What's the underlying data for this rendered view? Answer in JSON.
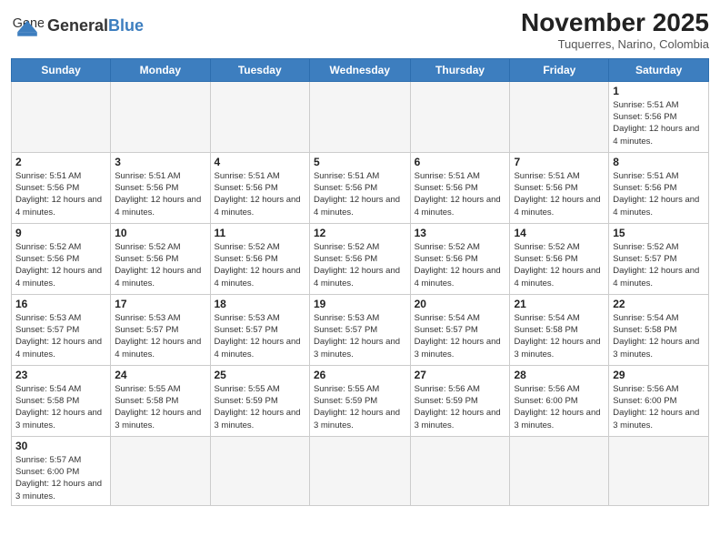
{
  "header": {
    "logo_general": "General",
    "logo_blue": "Blue",
    "month_title": "November 2025",
    "subtitle": "Tuquerres, Narino, Colombia"
  },
  "days_of_week": [
    "Sunday",
    "Monday",
    "Tuesday",
    "Wednesday",
    "Thursday",
    "Friday",
    "Saturday"
  ],
  "weeks": [
    [
      {
        "day": "",
        "info": ""
      },
      {
        "day": "",
        "info": ""
      },
      {
        "day": "",
        "info": ""
      },
      {
        "day": "",
        "info": ""
      },
      {
        "day": "",
        "info": ""
      },
      {
        "day": "",
        "info": ""
      },
      {
        "day": "1",
        "info": "Sunrise: 5:51 AM\nSunset: 5:56 PM\nDaylight: 12 hours and 4 minutes."
      }
    ],
    [
      {
        "day": "2",
        "info": "Sunrise: 5:51 AM\nSunset: 5:56 PM\nDaylight: 12 hours and 4 minutes."
      },
      {
        "day": "3",
        "info": "Sunrise: 5:51 AM\nSunset: 5:56 PM\nDaylight: 12 hours and 4 minutes."
      },
      {
        "day": "4",
        "info": "Sunrise: 5:51 AM\nSunset: 5:56 PM\nDaylight: 12 hours and 4 minutes."
      },
      {
        "day": "5",
        "info": "Sunrise: 5:51 AM\nSunset: 5:56 PM\nDaylight: 12 hours and 4 minutes."
      },
      {
        "day": "6",
        "info": "Sunrise: 5:51 AM\nSunset: 5:56 PM\nDaylight: 12 hours and 4 minutes."
      },
      {
        "day": "7",
        "info": "Sunrise: 5:51 AM\nSunset: 5:56 PM\nDaylight: 12 hours and 4 minutes."
      },
      {
        "day": "8",
        "info": "Sunrise: 5:51 AM\nSunset: 5:56 PM\nDaylight: 12 hours and 4 minutes."
      }
    ],
    [
      {
        "day": "9",
        "info": "Sunrise: 5:52 AM\nSunset: 5:56 PM\nDaylight: 12 hours and 4 minutes."
      },
      {
        "day": "10",
        "info": "Sunrise: 5:52 AM\nSunset: 5:56 PM\nDaylight: 12 hours and 4 minutes."
      },
      {
        "day": "11",
        "info": "Sunrise: 5:52 AM\nSunset: 5:56 PM\nDaylight: 12 hours and 4 minutes."
      },
      {
        "day": "12",
        "info": "Sunrise: 5:52 AM\nSunset: 5:56 PM\nDaylight: 12 hours and 4 minutes."
      },
      {
        "day": "13",
        "info": "Sunrise: 5:52 AM\nSunset: 5:56 PM\nDaylight: 12 hours and 4 minutes."
      },
      {
        "day": "14",
        "info": "Sunrise: 5:52 AM\nSunset: 5:56 PM\nDaylight: 12 hours and 4 minutes."
      },
      {
        "day": "15",
        "info": "Sunrise: 5:52 AM\nSunset: 5:57 PM\nDaylight: 12 hours and 4 minutes."
      }
    ],
    [
      {
        "day": "16",
        "info": "Sunrise: 5:53 AM\nSunset: 5:57 PM\nDaylight: 12 hours and 4 minutes."
      },
      {
        "day": "17",
        "info": "Sunrise: 5:53 AM\nSunset: 5:57 PM\nDaylight: 12 hours and 4 minutes."
      },
      {
        "day": "18",
        "info": "Sunrise: 5:53 AM\nSunset: 5:57 PM\nDaylight: 12 hours and 4 minutes."
      },
      {
        "day": "19",
        "info": "Sunrise: 5:53 AM\nSunset: 5:57 PM\nDaylight: 12 hours and 3 minutes."
      },
      {
        "day": "20",
        "info": "Sunrise: 5:54 AM\nSunset: 5:57 PM\nDaylight: 12 hours and 3 minutes."
      },
      {
        "day": "21",
        "info": "Sunrise: 5:54 AM\nSunset: 5:58 PM\nDaylight: 12 hours and 3 minutes."
      },
      {
        "day": "22",
        "info": "Sunrise: 5:54 AM\nSunset: 5:58 PM\nDaylight: 12 hours and 3 minutes."
      }
    ],
    [
      {
        "day": "23",
        "info": "Sunrise: 5:54 AM\nSunset: 5:58 PM\nDaylight: 12 hours and 3 minutes."
      },
      {
        "day": "24",
        "info": "Sunrise: 5:55 AM\nSunset: 5:58 PM\nDaylight: 12 hours and 3 minutes."
      },
      {
        "day": "25",
        "info": "Sunrise: 5:55 AM\nSunset: 5:59 PM\nDaylight: 12 hours and 3 minutes."
      },
      {
        "day": "26",
        "info": "Sunrise: 5:55 AM\nSunset: 5:59 PM\nDaylight: 12 hours and 3 minutes."
      },
      {
        "day": "27",
        "info": "Sunrise: 5:56 AM\nSunset: 5:59 PM\nDaylight: 12 hours and 3 minutes."
      },
      {
        "day": "28",
        "info": "Sunrise: 5:56 AM\nSunset: 6:00 PM\nDaylight: 12 hours and 3 minutes."
      },
      {
        "day": "29",
        "info": "Sunrise: 5:56 AM\nSunset: 6:00 PM\nDaylight: 12 hours and 3 minutes."
      }
    ],
    [
      {
        "day": "30",
        "info": "Sunrise: 5:57 AM\nSunset: 6:00 PM\nDaylight: 12 hours and 3 minutes."
      },
      {
        "day": "",
        "info": ""
      },
      {
        "day": "",
        "info": ""
      },
      {
        "day": "",
        "info": ""
      },
      {
        "day": "",
        "info": ""
      },
      {
        "day": "",
        "info": ""
      },
      {
        "day": "",
        "info": ""
      }
    ]
  ]
}
